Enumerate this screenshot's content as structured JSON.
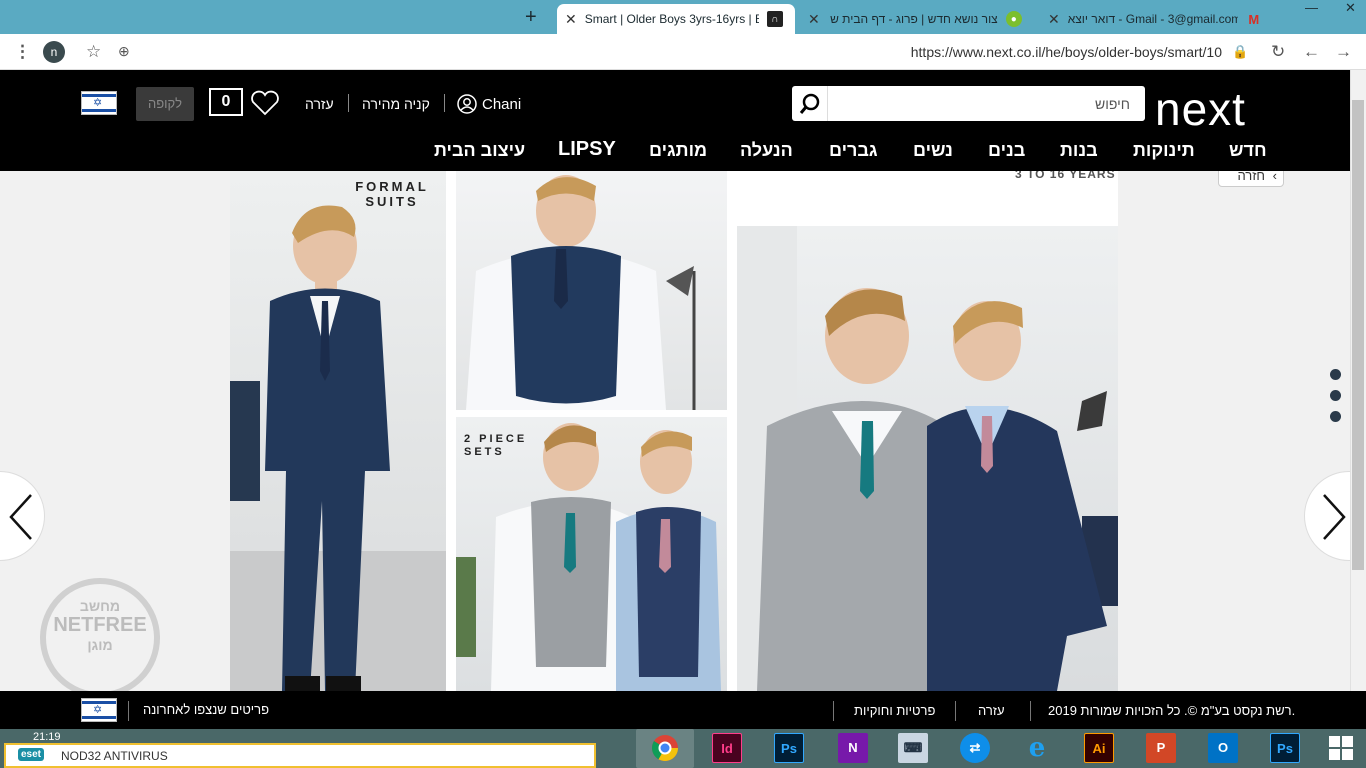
{
  "browser": {
    "tabs": [
      {
        "label": "Smart | Older Boys 3yrs-16yrs | B",
        "active": true,
        "favicon": "next-icon"
      },
      {
        "label": "צור נושא חדש | פרוג - דף הבית ש",
        "active": false,
        "favicon": "forum-icon"
      },
      {
        "label": "דואר יוצא - Gmail - 3@gmail.com",
        "active": false,
        "favicon": "gmail-icon"
      }
    ],
    "url": "https://www.next.co.il/he/boys/older-boys/smart/10",
    "profile_initial": "n"
  },
  "header": {
    "logo": "next",
    "search_placeholder": "חיפוש",
    "user_name": "Chani",
    "quick_buy": "קניה מהירה",
    "help": "עזרה",
    "bag_count": "0",
    "checkout": "לקופה"
  },
  "nav": [
    "חדש",
    "תינוקות",
    "בנות",
    "בנים",
    "נשים",
    "גברים",
    "הנעלה",
    "מותגים",
    "LIPSY",
    "עיצוב הבית"
  ],
  "content": {
    "formal_suits_line1": "FORMAL",
    "formal_suits_line2": "SUITS",
    "two_piece_line1": "2 PIECE",
    "two_piece_line2": "SETS",
    "years_label": "3 TO 16 YEARS",
    "back_label": "חזרה",
    "netfree_top": "מחשב",
    "netfree_mid": "NETFREE",
    "netfree_bottom": "מוגן"
  },
  "footer": {
    "recently_viewed": "פריטים שנצפו לאחרונה",
    "privacy": "פרטיות וחוקיות",
    "help": "עזרה",
    "copyright": "2019 רשת נקסט בע\"מ ©. כל הזכויות שמורות."
  },
  "taskbar": {
    "eset_tag": "eset",
    "eset_label": "NOD32 ANTIVIRUS",
    "clock": "21:19",
    "apps": [
      "chrome-icon",
      "indesign-icon",
      "photoshop-icon",
      "onenote-icon",
      "keyboard-icon",
      "teamviewer-icon",
      "ie-icon",
      "illustrator-icon",
      "powerpoint-icon",
      "outlook-icon",
      "photoshop-icon",
      "windows-icon"
    ],
    "app_labels": {
      "indesign": "Id",
      "photoshop": "Ps",
      "onenote": "N",
      "illustrator": "Ai",
      "powerpoint": "P",
      "outlook": "O"
    }
  },
  "colors": {
    "tabbar": "#5aaac2",
    "header_bg": "#000000",
    "taskbar": "#4a6868",
    "suit_navy": "#1f3352",
    "suit_grey": "#9a9ea2"
  }
}
